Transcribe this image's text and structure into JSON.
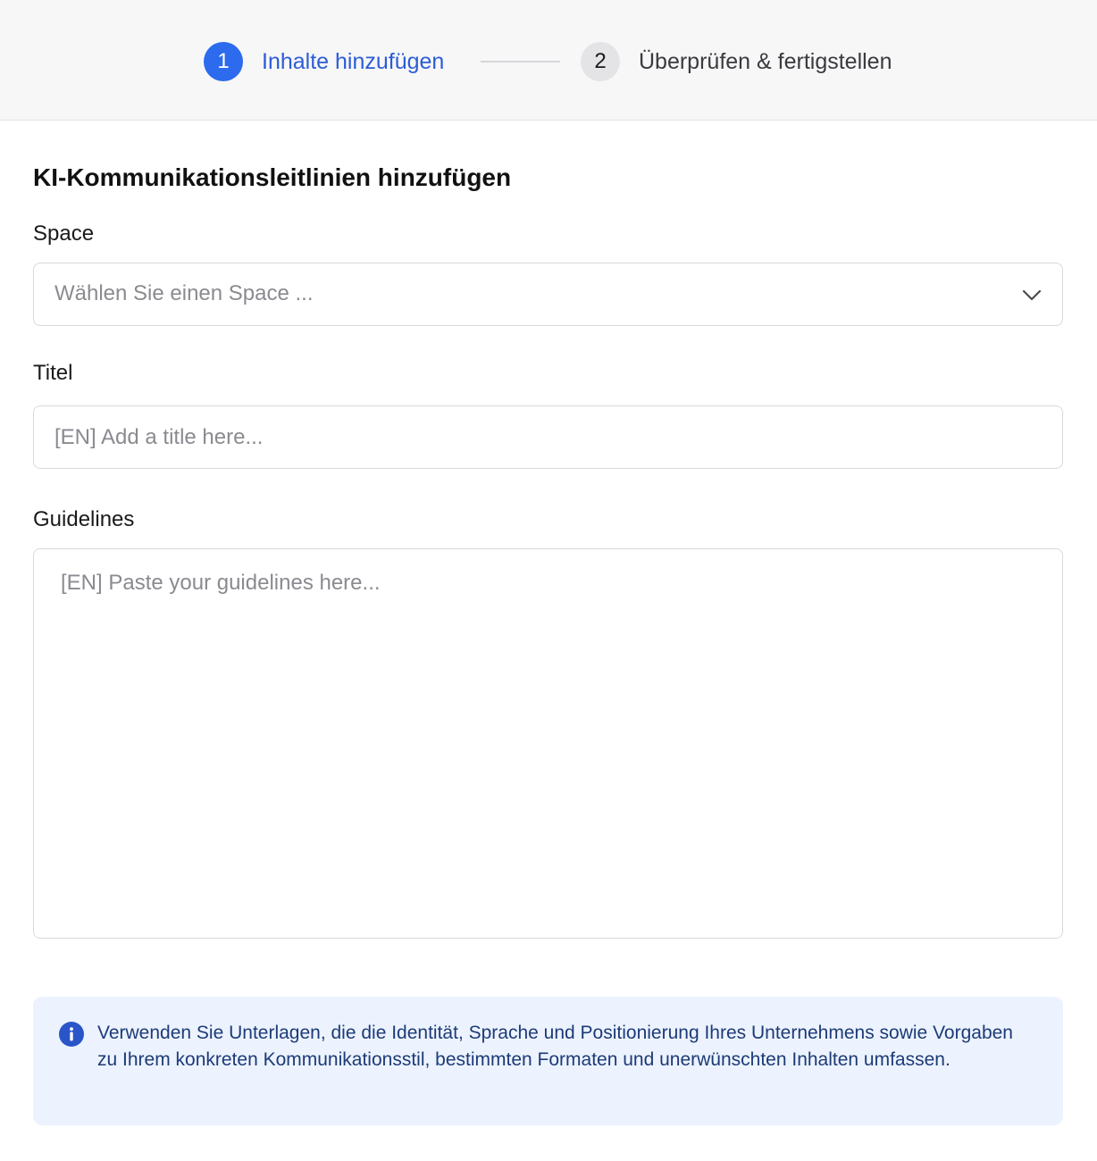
{
  "stepper": {
    "steps": [
      {
        "number": "1",
        "label": "Inhalte hinzufügen",
        "state": "active"
      },
      {
        "number": "2",
        "label": "Überprüfen & fertigstellen",
        "state": "inactive"
      }
    ]
  },
  "form": {
    "title": "KI-Kommunikationsleitlinien hinzufügen",
    "space": {
      "label": "Space",
      "placeholder": "Wählen Sie einen Space ...",
      "icon": "chevron-down-icon"
    },
    "titel": {
      "label": "Titel",
      "placeholder": "[EN] Add a title here..."
    },
    "guidelines": {
      "label": "Guidelines",
      "placeholder": "[EN] Paste your guidelines here..."
    }
  },
  "info": {
    "icon": "info-icon",
    "text": "Verwenden Sie Unterlagen, die die Identität, Sprache und Positionierung Ihres Unternehmens sowie Vorgaben zu Ihrem konkreten Kommunikationsstil, bestimmten Formaten und unerwünschten Inhalten umfassen."
  },
  "colors": {
    "accent": "#2c6bed",
    "info_background": "#ecf3fe",
    "info_text": "#1d3a78"
  }
}
